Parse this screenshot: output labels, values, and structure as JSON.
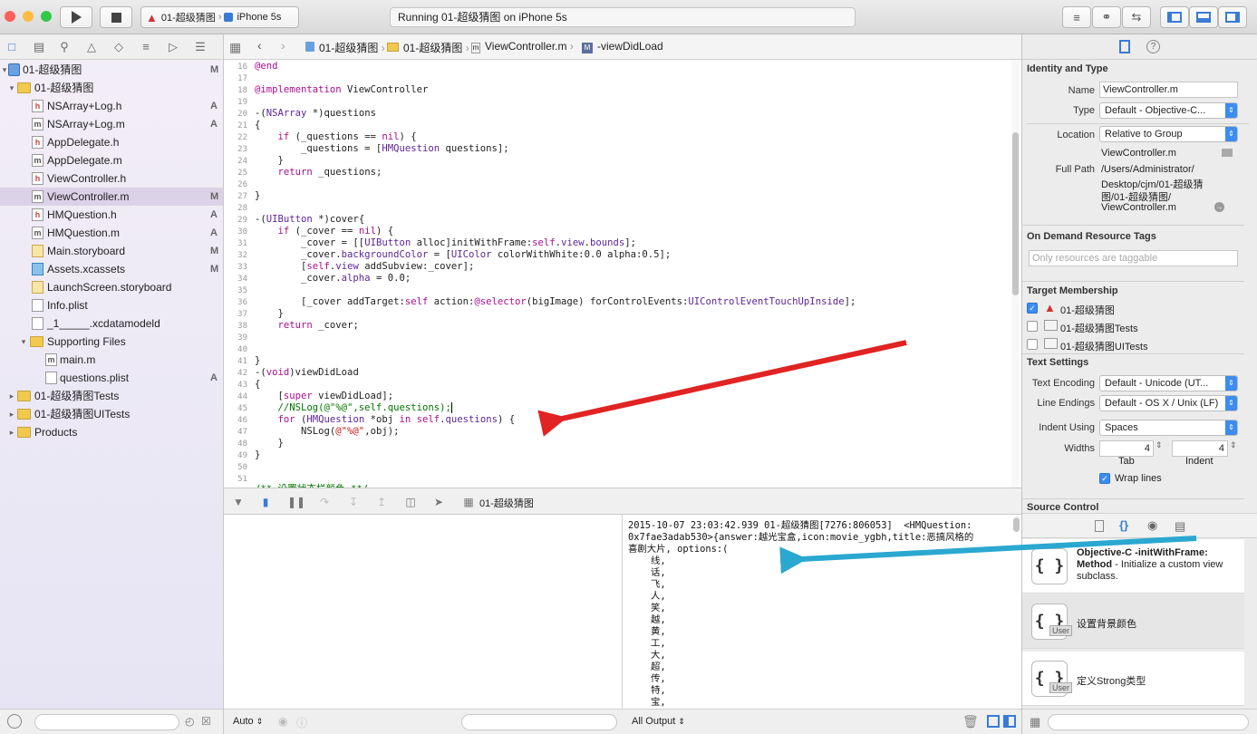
{
  "toolbar": {
    "scheme": "01-超级猜图",
    "device": "iPhone 5s",
    "status": "Running 01-超级猜图 on iPhone 5s"
  },
  "navigator": {
    "items": [
      {
        "label": "01-超级猜图",
        "badge": "M"
      },
      {
        "label": "01-超级猜图",
        "badge": ""
      },
      {
        "label": "NSArray+Log.h",
        "badge": "A"
      },
      {
        "label": "NSArray+Log.m",
        "badge": "A"
      },
      {
        "label": "AppDelegate.h",
        "badge": ""
      },
      {
        "label": "AppDelegate.m",
        "badge": ""
      },
      {
        "label": "ViewController.h",
        "badge": ""
      },
      {
        "label": "ViewController.m",
        "badge": "M"
      },
      {
        "label": "HMQuestion.h",
        "badge": "A"
      },
      {
        "label": "HMQuestion.m",
        "badge": "A"
      },
      {
        "label": "Main.storyboard",
        "badge": "M"
      },
      {
        "label": "Assets.xcassets",
        "badge": "M"
      },
      {
        "label": "LaunchScreen.storyboard",
        "badge": ""
      },
      {
        "label": "Info.plist",
        "badge": ""
      },
      {
        "label": "_1_____.xcdatamodeld",
        "badge": ""
      },
      {
        "label": "Supporting Files",
        "badge": ""
      },
      {
        "label": "main.m",
        "badge": ""
      },
      {
        "label": "questions.plist",
        "badge": "A"
      },
      {
        "label": "01-超级猜图Tests",
        "badge": ""
      },
      {
        "label": "01-超级猜图UITests",
        "badge": ""
      },
      {
        "label": "Products",
        "badge": ""
      }
    ]
  },
  "jumpbar": {
    "crumbs": [
      "01-超级猜图",
      "01-超级猜图",
      "ViewController.m",
      "-viewDidLoad"
    ]
  },
  "editor": {
    "line_numbers": [
      "16",
      "17",
      "18",
      "19",
      "20",
      "21",
      "22",
      "23",
      "24",
      "25",
      "26",
      "27",
      "28",
      "29",
      "30",
      "31",
      "32",
      "33",
      "34",
      "35",
      "36",
      "37",
      "38",
      "39",
      "40",
      "41",
      "42",
      "43",
      "44",
      "45",
      "46",
      "47",
      "48",
      "49",
      "50",
      "51"
    ]
  },
  "debug": {
    "target": "01-超级猜图"
  },
  "console": {
    "lines": [
      "2015-10-07 23:03:42.939 01-超级猜图[7276:806053]  <HMQuestion:",
      "0x7fae3adab530>{answer:越光宝盒,icon:movie_ygbh,title:恶搞风格的",
      "喜剧大片, options:(",
      "    线,",
      "    话,",
      "    飞,",
      "    人,",
      "    笑,",
      "    越,",
      "    黄,",
      "    工,",
      "    大,",
      "    超,",
      "    传,",
      "    特,",
      "    宝,"
    ]
  },
  "bottombar": {
    "auto": "Auto",
    "output": "All Output"
  },
  "inspector": {
    "identity_title": "Identity and Type",
    "name_label": "Name",
    "name_value": "ViewController.m",
    "type_label": "Type",
    "type_value": "Default - Objective-C...",
    "location_label": "Location",
    "location_value": "Relative to Group",
    "location_file": "ViewController.m",
    "fullpath_label": "Full Path",
    "fullpath_lines": [
      "/Users/Administrator/",
      "Desktop/cjm/01-超级猜",
      "图/01-超级猜图/",
      "ViewController.m"
    ],
    "odr_title": "On Demand Resource Tags",
    "odr_placeholder": "Only resources are taggable",
    "target_title": "Target Membership",
    "targets": [
      "01-超级猜图",
      "01-超级猜图Tests",
      "01-超级猜图UITests"
    ],
    "text_title": "Text Settings",
    "encoding_label": "Text Encoding",
    "encoding_value": "Default - Unicode (UT...",
    "endings_label": "Line Endings",
    "endings_value": "Default - OS X / Unix (LF)",
    "indent_label": "Indent Using",
    "indent_value": "Spaces",
    "widths_label": "Widths",
    "tab_value": "4",
    "indent_width_value": "4",
    "tab_label": "Tab",
    "indent_sub_label": "Indent",
    "wrap_label": "Wrap lines",
    "source_title": "Source Control",
    "snippets": [
      {
        "title": "Objective-C -initWithFrame: Method",
        "desc": " - Initialize a custom view subclass."
      },
      {
        "title": "设置背景颜色",
        "desc": ""
      },
      {
        "title": "定义Strong类型",
        "desc": ""
      }
    ],
    "user_tag": "User"
  }
}
